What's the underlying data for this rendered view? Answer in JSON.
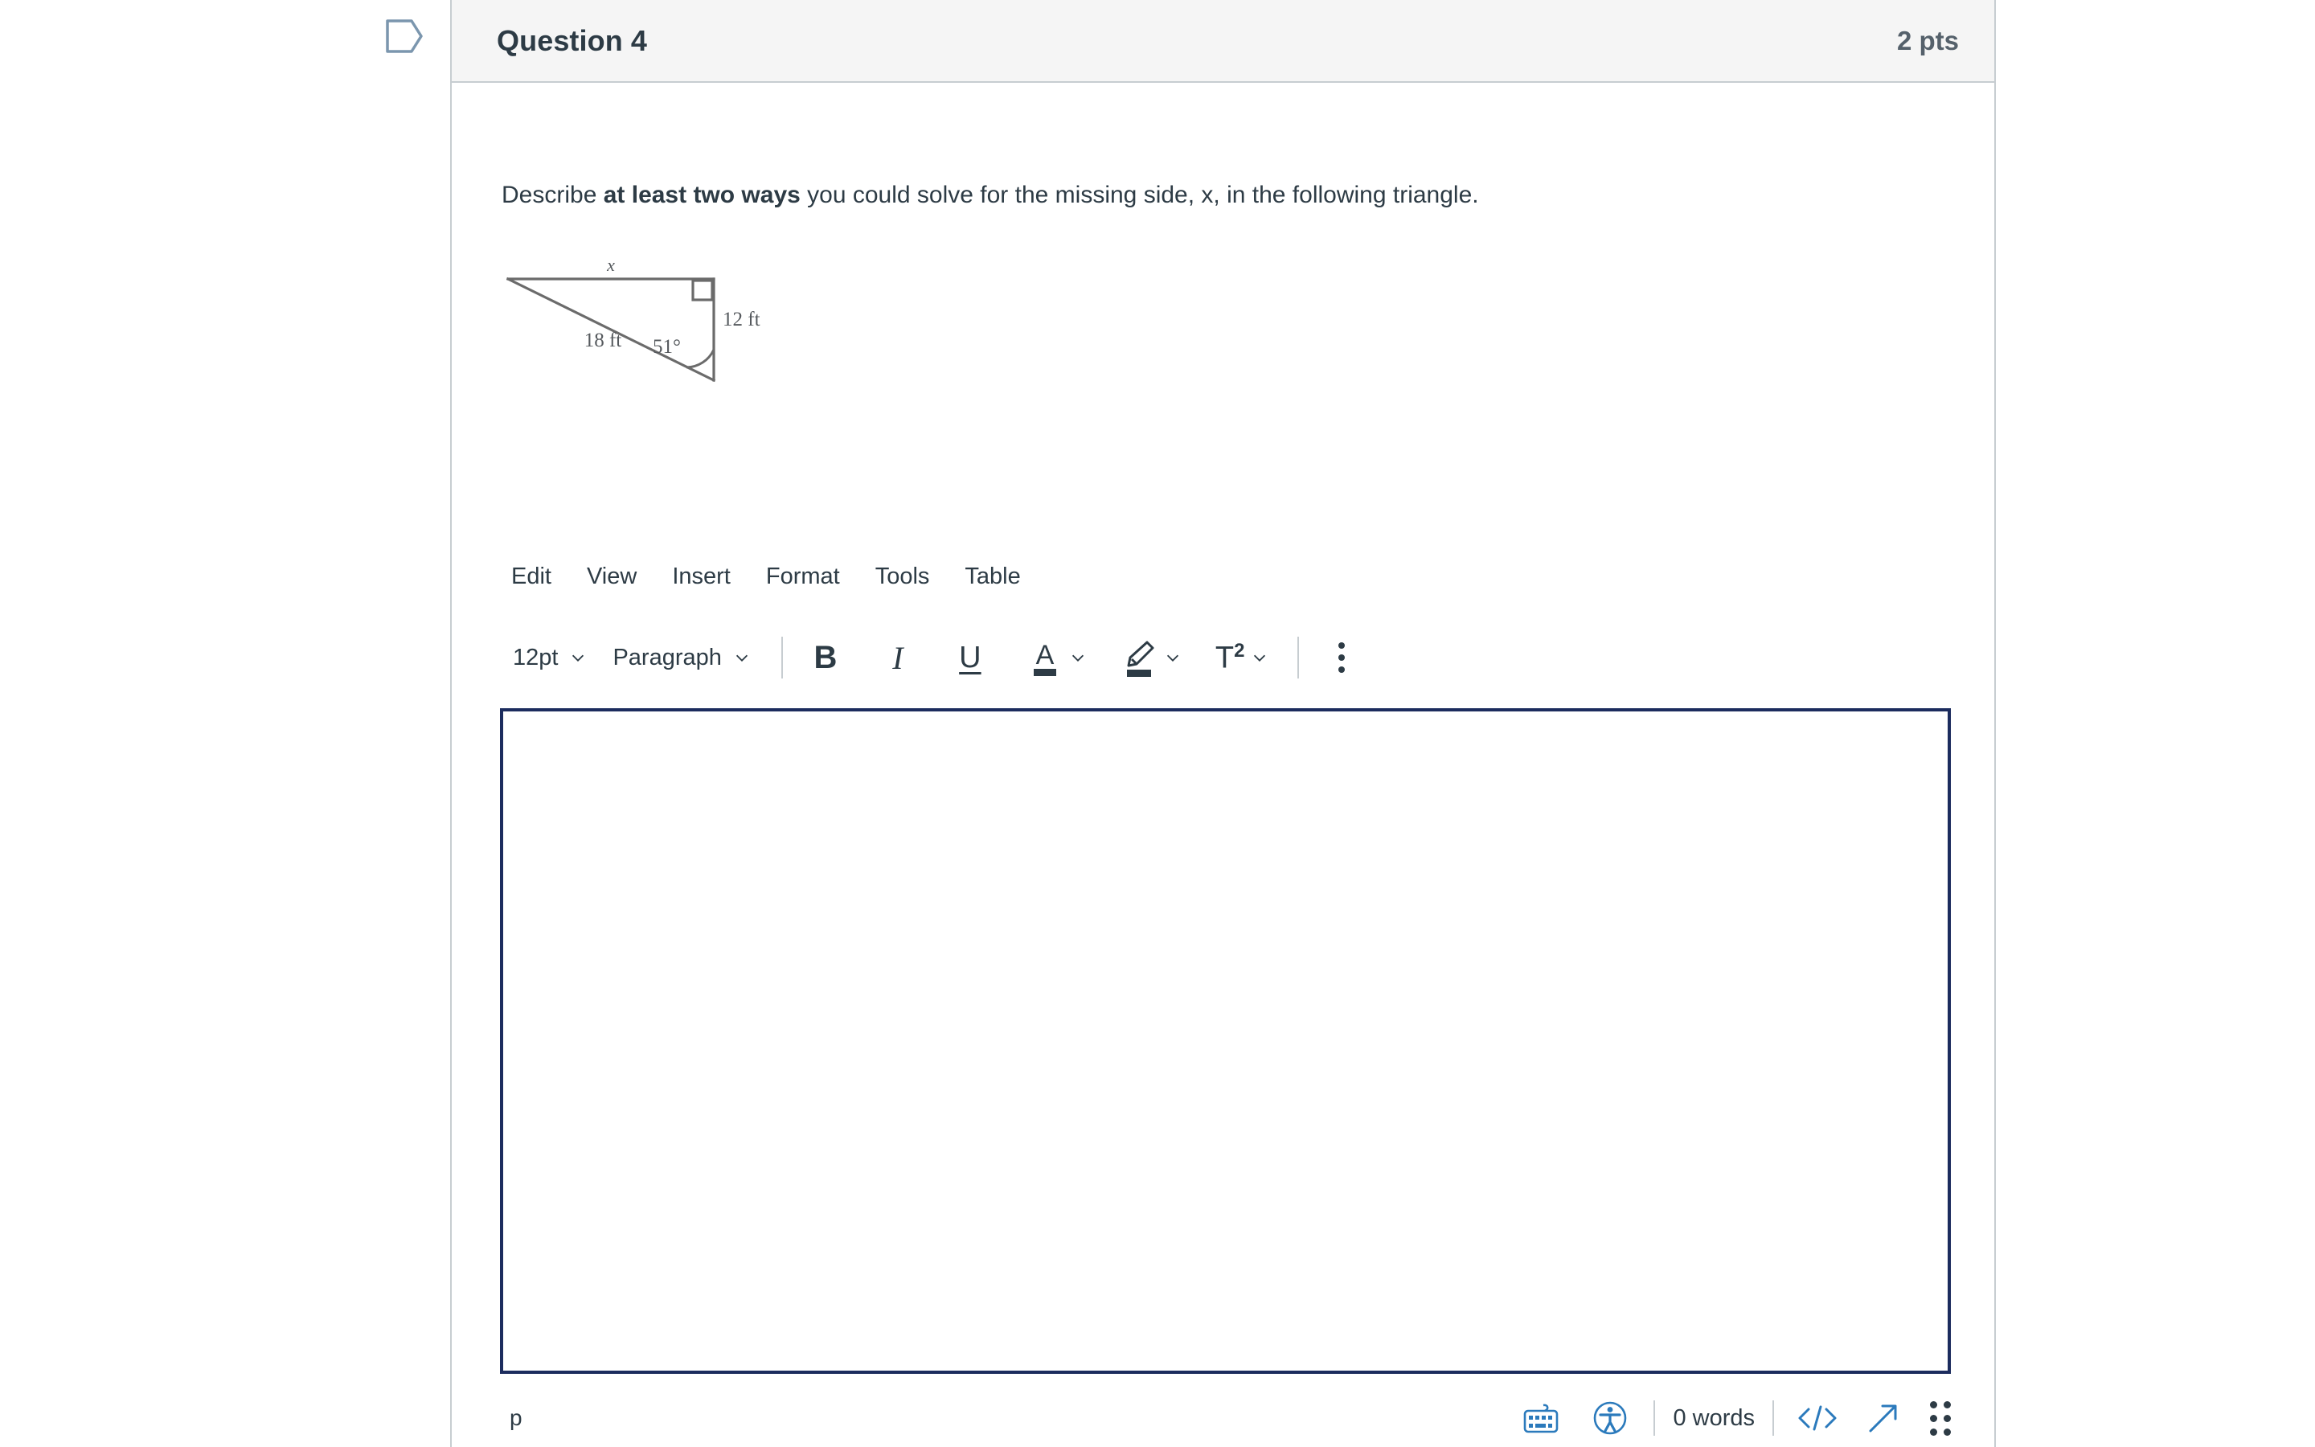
{
  "header": {
    "flag_icon": "bookmark-flag-icon",
    "title": "Question 4",
    "points": "2 pts"
  },
  "question": {
    "prompt_part1": "Describe ",
    "prompt_bold": "at least two ways",
    "prompt_part2": " you could solve for the missing side, x, in the following triangle."
  },
  "figure": {
    "alt": "right triangle diagram",
    "labels": {
      "top_side": "x",
      "hypotenuse": "18 ft",
      "right_side": "12 ft",
      "angle": "51°"
    },
    "stroke_color": "#6b6b6b"
  },
  "editor": {
    "menubar": [
      {
        "label": "Edit"
      },
      {
        "label": "View"
      },
      {
        "label": "Insert"
      },
      {
        "label": "Format"
      },
      {
        "label": "Tools"
      },
      {
        "label": "Table"
      }
    ],
    "toolbar": {
      "font_size": "12pt",
      "block_format": "Paragraph",
      "bold": "B",
      "italic": "I",
      "underline": "U",
      "text_color": "A",
      "highlight_icon": "highlighter-icon",
      "superscript": "T",
      "superscript_exp": "2",
      "more_icon": "kebab-menu-icon"
    },
    "content": "",
    "border_color": "#1c2c5e"
  },
  "status_bar": {
    "element_path": "p",
    "keyboard_icon": "keyboard-shortcuts-icon",
    "a11y_icon": "accessibility-checker-icon",
    "word_count": "0 words",
    "html_editor": "</>",
    "fullscreen_icon": "expand-arrow-icon",
    "resize_handle": "resize-grip-icon",
    "accent_color": "#2b7abc"
  }
}
